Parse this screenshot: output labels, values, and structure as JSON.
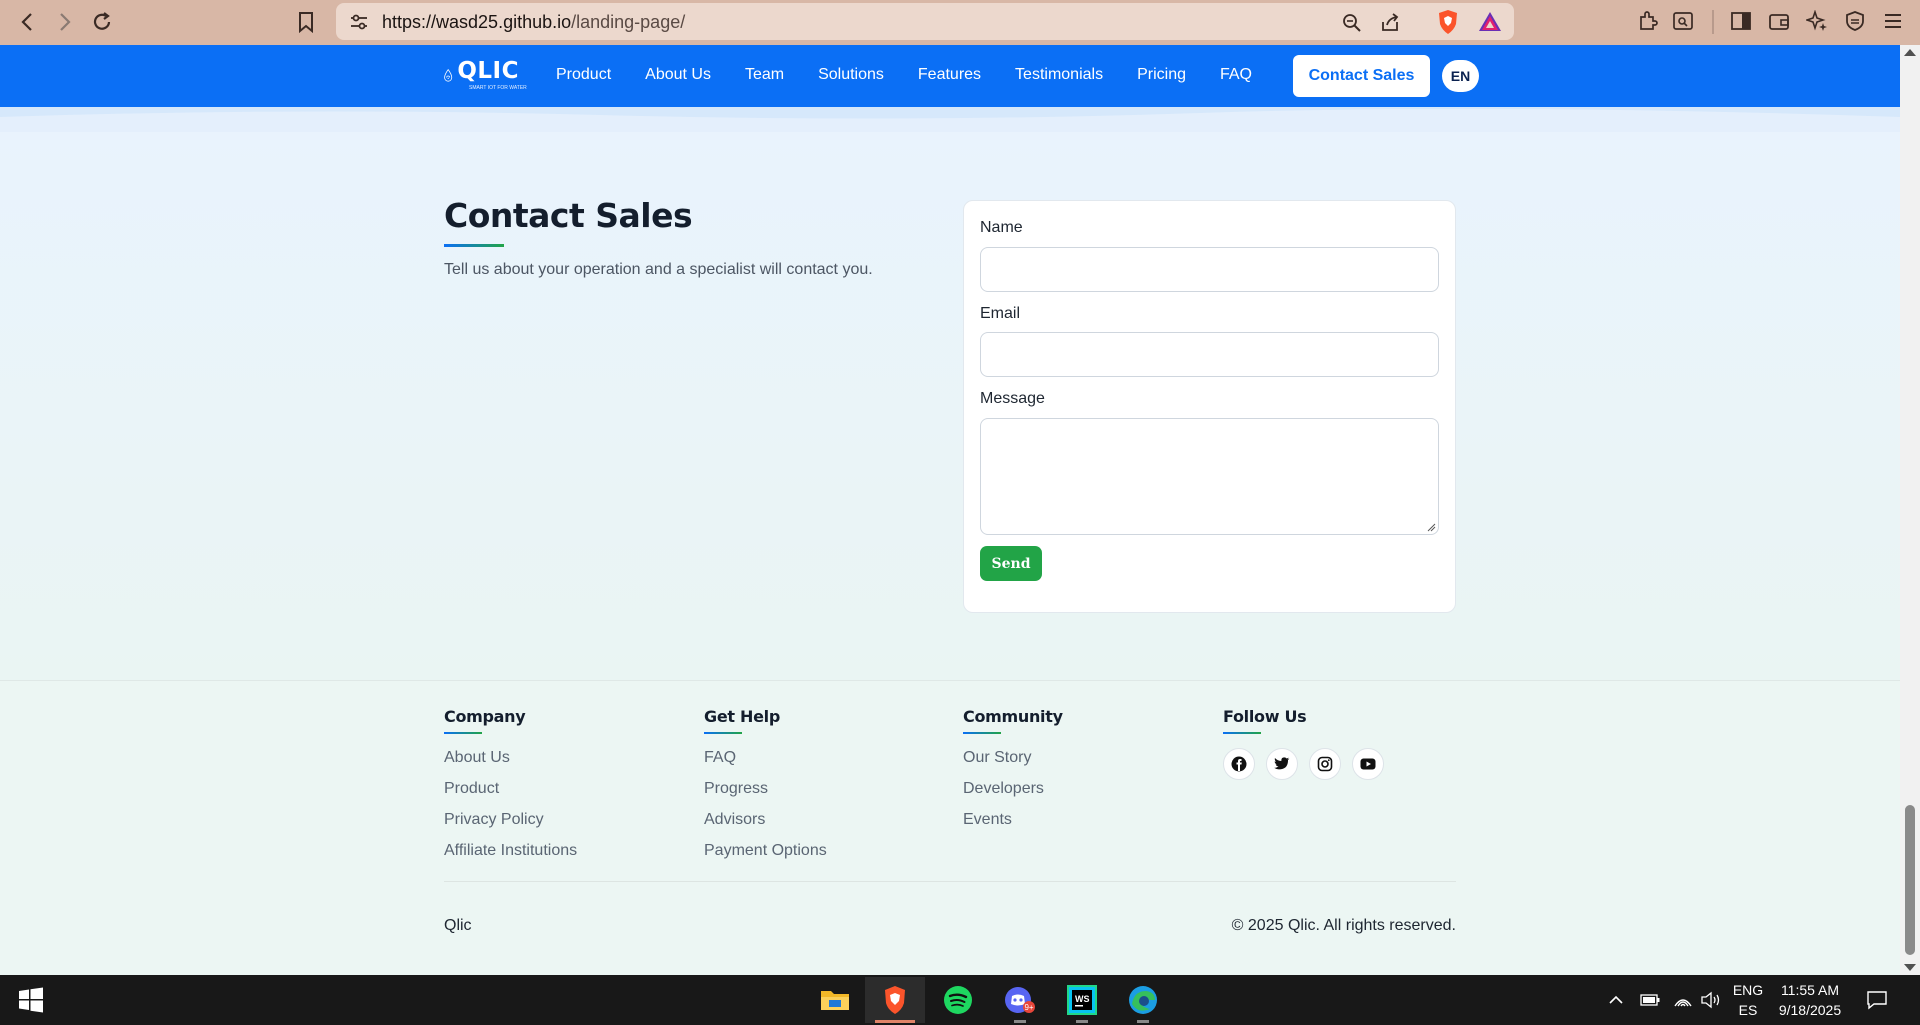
{
  "browser": {
    "url_host": "https://wasd25.github.io",
    "url_path": "/landing-page/",
    "back_icon": "back-arrow-icon",
    "forward_icon": "forward-arrow-icon",
    "reload_icon": "reload-icon",
    "bookmark_icon": "bookmark-icon"
  },
  "site_nav": {
    "logo_text": "QLIC",
    "logo_tagline": "SMART IOT FOR WATER",
    "links": [
      "Product",
      "About Us",
      "Team",
      "Solutions",
      "Features",
      "Testimonials",
      "Pricing",
      "FAQ"
    ],
    "cta": "Contact Sales",
    "lang": "EN",
    "color": "#0b6ff5"
  },
  "contact": {
    "title": "Contact Sales",
    "lead": "Tell us about your operation and a specialist will contact you.",
    "form": {
      "name_label": "Name",
      "name_value": "",
      "email_label": "Email",
      "email_value": "",
      "message_label": "Message",
      "message_value": "",
      "send_label": "Send",
      "send_color": "#22a447"
    }
  },
  "footer": {
    "columns": [
      {
        "title": "Company",
        "items": [
          "About Us",
          "Product",
          "Privacy Policy",
          "Affiliate Institutions"
        ]
      },
      {
        "title": "Get Help",
        "items": [
          "FAQ",
          "Progress",
          "Advisors",
          "Payment Options"
        ]
      },
      {
        "title": "Community",
        "items": [
          "Our Story",
          "Developers",
          "Events"
        ]
      }
    ],
    "follow_title": "Follow Us",
    "social": [
      "facebook-icon",
      "twitter-icon",
      "instagram-icon",
      "youtube-icon"
    ],
    "brand": "Qlic",
    "copyright": "© 2025 Qlic. All rights reserved."
  },
  "taskbar": {
    "apps": [
      "file-explorer-icon",
      "brave-icon",
      "spotify-icon",
      "discord-icon",
      "webstorm-icon",
      "edge-icon"
    ],
    "lang_top": "ENG",
    "lang_bottom": "ES",
    "time": "11:55 AM",
    "date": "9/18/2025"
  }
}
